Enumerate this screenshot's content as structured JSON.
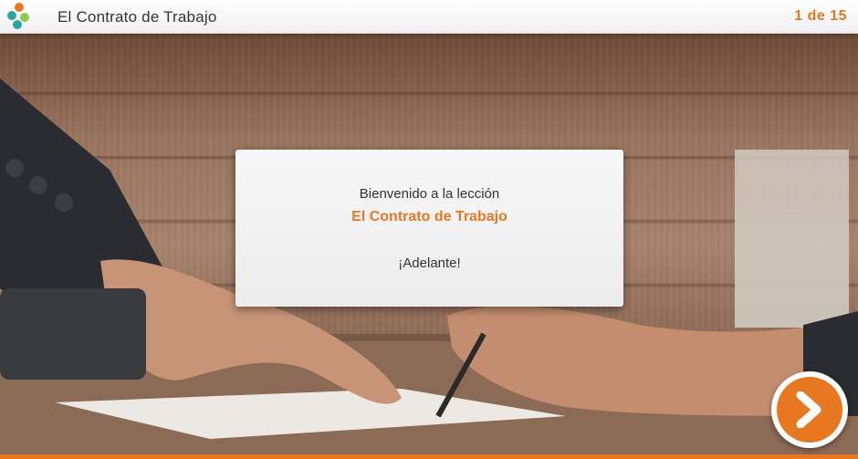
{
  "header": {
    "title": "El Contrato de Trabajo",
    "page_counter": "1 de 15"
  },
  "card": {
    "welcome_text": "Bienvenido a la lección",
    "lesson_title": "El Contrato de Trabajo",
    "cta_text": "¡Adelante!"
  },
  "colors": {
    "accent": "#e87722",
    "logo_dots": [
      "#e87722",
      "#2aa6a0",
      "#8cc84b",
      "#2aa6a0"
    ]
  },
  "icons": {
    "logo": "app-logo-icon",
    "next": "chevron-right-icon"
  }
}
